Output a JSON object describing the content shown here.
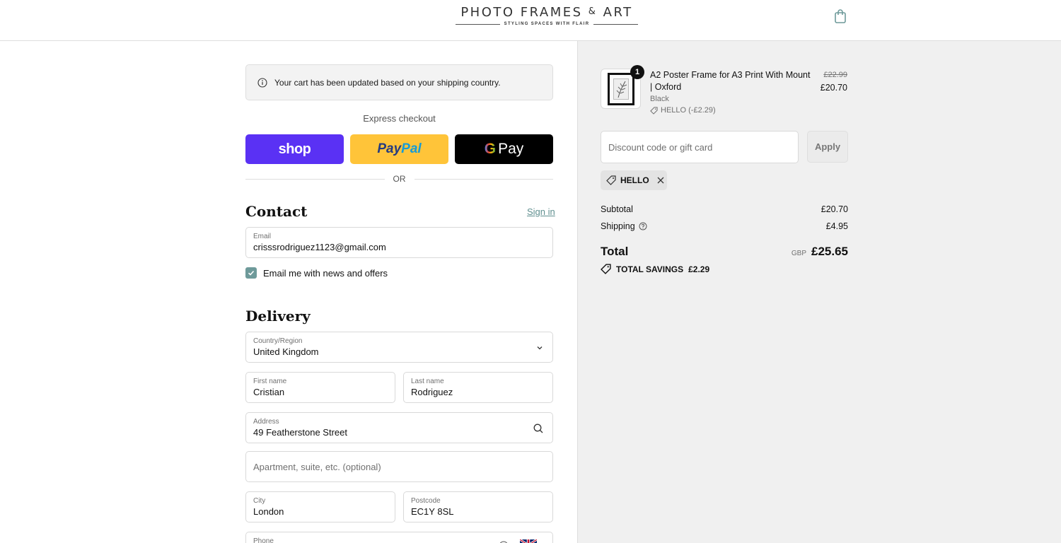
{
  "header": {
    "logo_main": "PHOTO FRAMES",
    "logo_amp": "&",
    "logo_end": "ART",
    "logo_tagline": "STYLING SPACES WITH FLAIR",
    "cart_icon": "shopping-bag-icon"
  },
  "notice": {
    "text": "Your cart has been updated based on your shipping country.",
    "icon": "info-icon"
  },
  "express": {
    "label": "Express checkout",
    "shop_label": "shop",
    "paypal_part1": "Pay",
    "paypal_part2": "Pal",
    "gpay_g": "G",
    "gpay_label": "Pay",
    "or_label": "OR"
  },
  "contact": {
    "title": "Contact",
    "signin_label": "Sign in",
    "email_label": "Email",
    "email_value": "crisssrodriguez1123@gmail.com",
    "newsletter_label": "Email me with news and offers",
    "newsletter_checked": true
  },
  "delivery": {
    "title": "Delivery",
    "country_label": "Country/Region",
    "country_value": "United Kingdom",
    "first_name_label": "First name",
    "first_name_value": "Cristian",
    "last_name_label": "Last name",
    "last_name_value": "Rodriguez",
    "address_label": "Address",
    "address_value": "49 Featherstone Street",
    "apartment_placeholder": "Apartment, suite, etc. (optional)",
    "city_label": "City",
    "city_value": "London",
    "postcode_label": "Postcode",
    "postcode_value": "EC1Y 8SL",
    "phone_label": "Phone"
  },
  "summary": {
    "item": {
      "quantity": "1",
      "name": "A2 Poster Frame for A3 Print With Mount | Oxford",
      "variant": "Black",
      "discount": "HELLO (-£2.29)",
      "price_old": "£22.99",
      "price_new": "£20.70"
    },
    "discount_placeholder": "Discount code or gift card",
    "apply_label": "Apply",
    "applied_code": "HELLO",
    "subtotal_label": "Subtotal",
    "subtotal_value": "£20.70",
    "shipping_label": "Shipping",
    "shipping_value": "£4.95",
    "total_label": "Total",
    "currency": "GBP",
    "total_value": "£25.65",
    "savings_label": "TOTAL SAVINGS",
    "savings_value": "£2.29"
  },
  "colors": {
    "shop_purple": "#5a31f4",
    "paypal_yellow": "#ffc439",
    "accent_teal": "#6e9a9a"
  }
}
